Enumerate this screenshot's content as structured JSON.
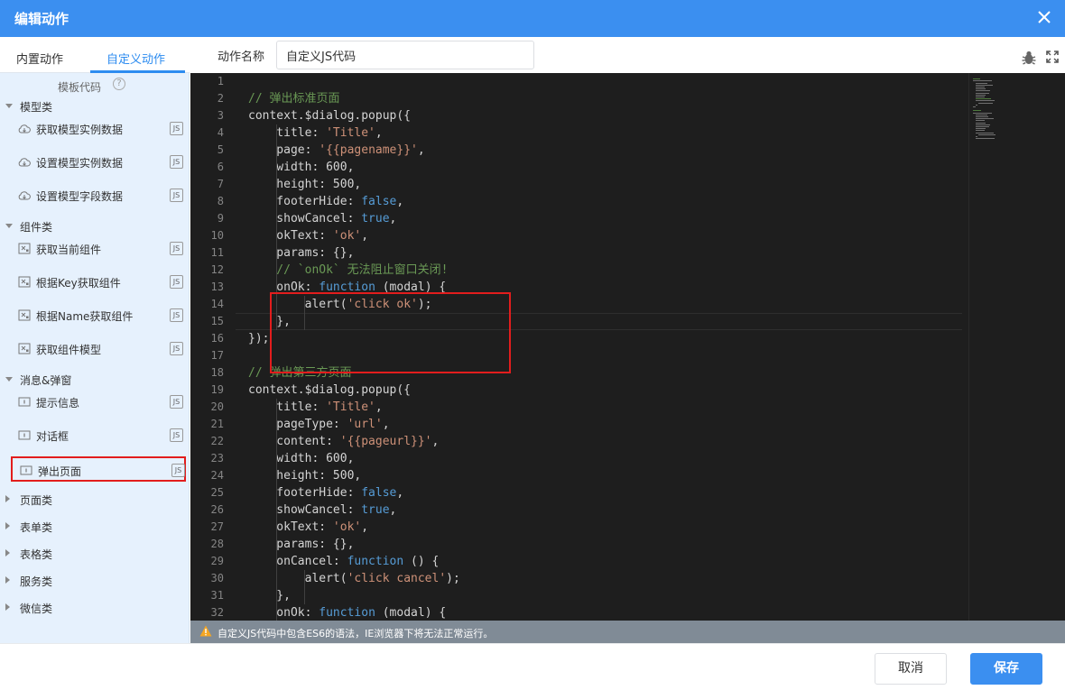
{
  "dialog": {
    "title": "编辑动作"
  },
  "tabs": [
    {
      "label": "内置动作"
    },
    {
      "label": "自定义动作"
    }
  ],
  "template_label": "模板代码",
  "categories": [
    {
      "label": "模型类",
      "expanded": true,
      "items": [
        {
          "label": "获取模型实例数据"
        },
        {
          "label": "设置模型实例数据"
        },
        {
          "label": "设置模型字段数据"
        }
      ]
    },
    {
      "label": "组件类",
      "expanded": true,
      "items": [
        {
          "label": "获取当前组件"
        },
        {
          "label": "根据Key获取组件"
        },
        {
          "label": "根据Name获取组件"
        },
        {
          "label": "获取组件模型"
        }
      ]
    },
    {
      "label": "消息&弹窗",
      "expanded": true,
      "items": [
        {
          "label": "提示信息"
        },
        {
          "label": "对话框"
        },
        {
          "label": "弹出页面"
        }
      ]
    },
    {
      "label": "页面类",
      "expanded": false
    },
    {
      "label": "表单类",
      "expanded": false
    },
    {
      "label": "表格类",
      "expanded": false
    },
    {
      "label": "服务类",
      "expanded": false
    },
    {
      "label": "微信类",
      "expanded": false
    }
  ],
  "js_badge": "JS",
  "action_name": {
    "label": "动作名称",
    "value": "自定义JS代码"
  },
  "code": {
    "line_numbers": [
      "1",
      "2",
      "3",
      "4",
      "5",
      "6",
      "7",
      "8",
      "9",
      "10",
      "11",
      "12",
      "13",
      "14",
      "15",
      "16",
      "17",
      "18",
      "19",
      "20",
      "21",
      "22",
      "23",
      "24",
      "25",
      "26",
      "27",
      "28",
      "29",
      "30",
      "31",
      "32"
    ],
    "lines": [
      [],
      [
        [
          "c",
          "// 弹出标准页面"
        ]
      ],
      [
        [
          "p",
          "context.$dialog.popup({"
        ]
      ],
      [
        [
          "p",
          "    title: "
        ],
        [
          "s",
          "'Title'"
        ],
        [
          "p",
          ","
        ]
      ],
      [
        [
          "p",
          "    page: "
        ],
        [
          "s",
          "'{{pagename}}'"
        ],
        [
          "p",
          ","
        ]
      ],
      [
        [
          "p",
          "    width: 600,"
        ]
      ],
      [
        [
          "p",
          "    height: 500,"
        ]
      ],
      [
        [
          "p",
          "    footerHide: "
        ],
        [
          "k",
          "false"
        ],
        [
          "p",
          ","
        ]
      ],
      [
        [
          "p",
          "    showCancel: "
        ],
        [
          "k",
          "true"
        ],
        [
          "p",
          ","
        ]
      ],
      [
        [
          "p",
          "    okText: "
        ],
        [
          "s",
          "'ok'"
        ],
        [
          "p",
          ","
        ]
      ],
      [
        [
          "p",
          "    params: {},"
        ]
      ],
      [
        [
          "c",
          "    // `onOk` 无法阻止窗口关闭!"
        ]
      ],
      [
        [
          "p",
          "    onOk: "
        ],
        [
          "k",
          "function"
        ],
        [
          "p",
          " (modal) {"
        ]
      ],
      [
        [
          "p",
          "        alert("
        ],
        [
          "s",
          "'click ok'"
        ],
        [
          "p",
          ");"
        ]
      ],
      [
        [
          "p",
          "    },"
        ]
      ],
      [
        [
          "p",
          "});"
        ]
      ],
      [],
      [
        [
          "c",
          "// 弹出第三方页面"
        ]
      ],
      [
        [
          "p",
          "context.$dialog.popup({"
        ]
      ],
      [
        [
          "p",
          "    title: "
        ],
        [
          "s",
          "'Title'"
        ],
        [
          "p",
          ","
        ]
      ],
      [
        [
          "p",
          "    pageType: "
        ],
        [
          "s",
          "'url'"
        ],
        [
          "p",
          ","
        ]
      ],
      [
        [
          "p",
          "    content: "
        ],
        [
          "s",
          "'{{pageurl}}'"
        ],
        [
          "p",
          ","
        ]
      ],
      [
        [
          "p",
          "    width: 600,"
        ]
      ],
      [
        [
          "p",
          "    height: 500,"
        ]
      ],
      [
        [
          "p",
          "    footerHide: "
        ],
        [
          "k",
          "false"
        ],
        [
          "p",
          ","
        ]
      ],
      [
        [
          "p",
          "    showCancel: "
        ],
        [
          "k",
          "true"
        ],
        [
          "p",
          ","
        ]
      ],
      [
        [
          "p",
          "    okText: "
        ],
        [
          "s",
          "'ok'"
        ],
        [
          "p",
          ","
        ]
      ],
      [
        [
          "p",
          "    params: {},"
        ]
      ],
      [
        [
          "p",
          "    onCancel: "
        ],
        [
          "k",
          "function"
        ],
        [
          "p",
          " () {"
        ]
      ],
      [
        [
          "p",
          "        alert("
        ],
        [
          "s",
          "'click cancel'"
        ],
        [
          "p",
          ");"
        ]
      ],
      [
        [
          "p",
          "    },"
        ]
      ],
      [
        [
          "p",
          "    onOk: "
        ],
        [
          "k",
          "function"
        ],
        [
          "p",
          " (modal) {"
        ]
      ]
    ]
  },
  "warning": "自定义JS代码中包含ES6的语法，IE浏览器下将无法正常运行。",
  "buttons": {
    "cancel": "取消",
    "save": "保存"
  },
  "colors": {
    "header": "#3b8ff0",
    "accent": "#2d8cf0",
    "highlight_border": "#e21d1d",
    "editor_bg": "#1e1e1e",
    "comment": "#6a9955",
    "string": "#ce9178",
    "keyword": "#569cd6"
  },
  "icons": {
    "close": "close-icon",
    "help": "question-icon",
    "bug": "bug-icon",
    "fullscreen": "fullscreen-icon",
    "warning": "warning-icon",
    "model": "cloud-icon",
    "component": "component-icon",
    "message": "message-icon",
    "js": "js-file-icon"
  }
}
